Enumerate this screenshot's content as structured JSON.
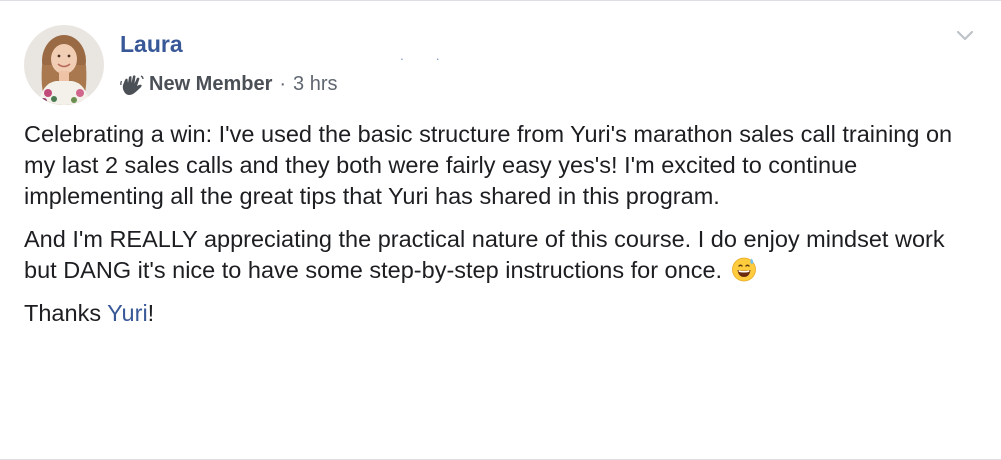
{
  "post": {
    "author": "Laura",
    "badge": "New Member",
    "separator": "·",
    "timestamp": "3 hrs",
    "dots": ". .",
    "paragraphs": [
      "Celebrating a win: I've used the basic structure from Yuri's marathon sales call training on my last 2 sales calls and they both were fairly easy yes's! I'm excited to continue implementing all the great tips that Yuri has shared in this program.",
      "And I'm REALLY appreciating the practical nature of this course. I do enjoy mindset work but DANG it's nice to have some step-by-step instructions for once."
    ],
    "thanks_prefix": "Thanks ",
    "mention": "Yuri",
    "thanks_suffix": "!",
    "icons": {
      "badge_icon": "waving-hand-icon",
      "options_icon": "chevron-down-icon",
      "emoji": "grinning-sweat-emoji"
    },
    "colors": {
      "link": "#385898",
      "meta": "#606770",
      "text": "#1c1e21"
    }
  }
}
